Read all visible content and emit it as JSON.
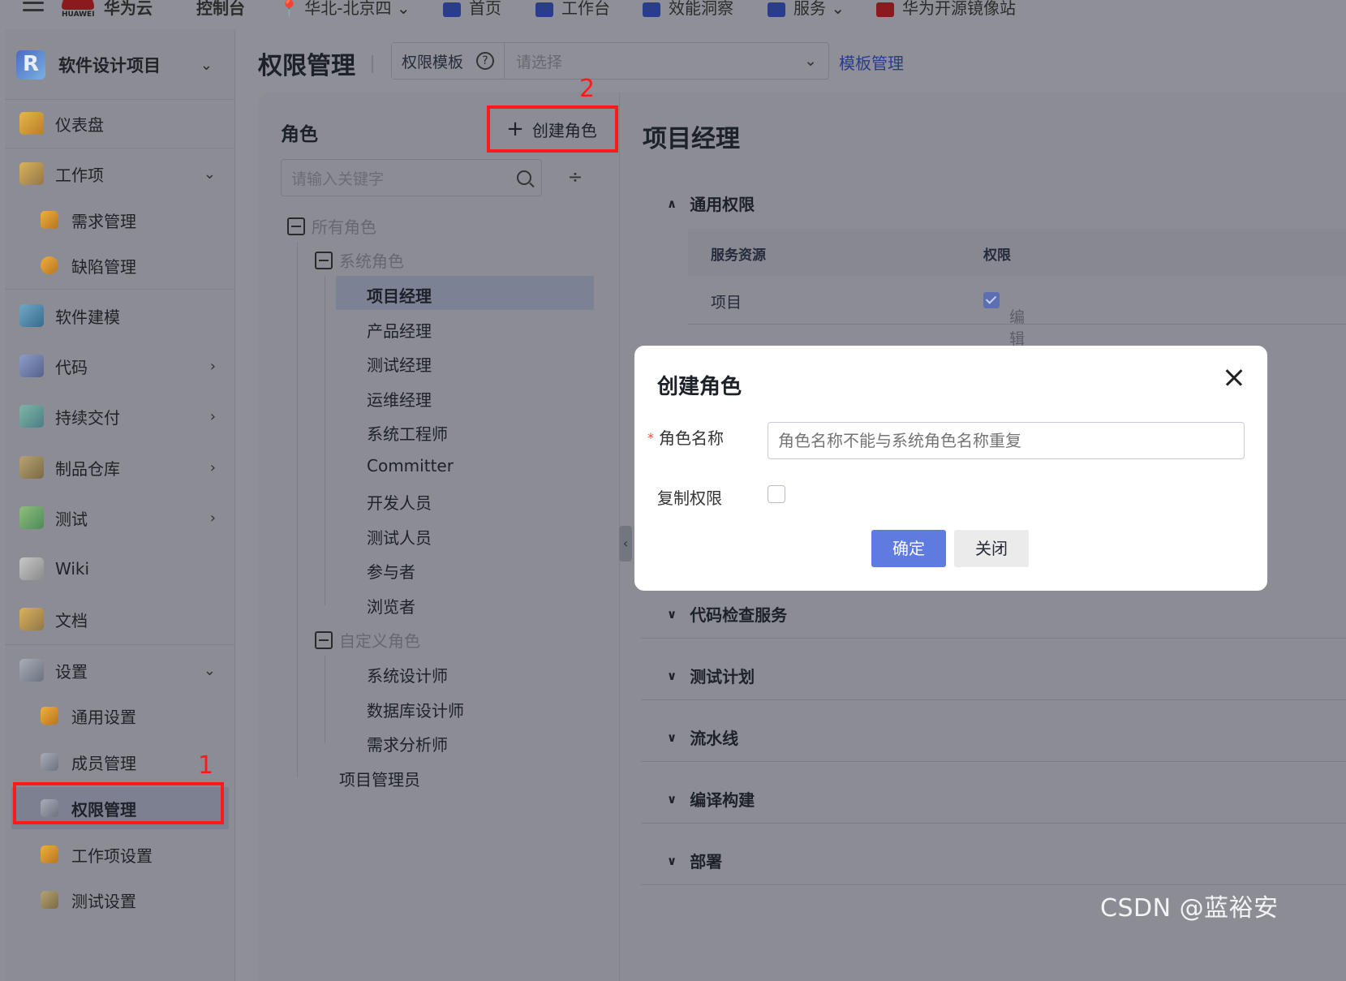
{
  "topnav": {
    "brand": "HUAWEI",
    "cloud_name": "华为云",
    "console": "控制台",
    "region": "华北-北京四",
    "home": "首页",
    "workbench": "工作台",
    "insight": "效能洞察",
    "services": "服务",
    "mirror": "华为开源镜像站"
  },
  "sidebar": {
    "project_name": "软件设计项目",
    "items": [
      {
        "label": "仪表盘"
      },
      {
        "label": "工作项"
      },
      {
        "label": "需求管理"
      },
      {
        "label": "缺陷管理"
      },
      {
        "label": "软件建模"
      },
      {
        "label": "代码"
      },
      {
        "label": "持续交付"
      },
      {
        "label": "制品仓库"
      },
      {
        "label": "测试"
      },
      {
        "label": "Wiki"
      },
      {
        "label": "文档"
      },
      {
        "label": "设置"
      },
      {
        "label": "通用设置"
      },
      {
        "label": "成员管理"
      },
      {
        "label": "权限管理"
      },
      {
        "label": "工作项设置"
      },
      {
        "label": "测试设置"
      }
    ]
  },
  "annotations": {
    "step1": "1",
    "step2": "2"
  },
  "header": {
    "title": "权限管理",
    "template_label": "权限模板",
    "template_placeholder": "请选择",
    "template_link": "模板管理"
  },
  "roles_panel": {
    "heading": "角色",
    "create_label": "创建角色",
    "search_placeholder": "请输入关键字",
    "root": "所有角色",
    "system_group": "系统角色",
    "system_roles": [
      "项目经理",
      "产品经理",
      "测试经理",
      "运维经理",
      "系统工程师",
      "Committer",
      "开发人员",
      "测试人员",
      "参与者",
      "浏览者"
    ],
    "custom_group": "自定义角色",
    "custom_roles": [
      "系统设计师",
      "数据库设计师",
      "需求分析师"
    ],
    "admin": "项目管理员"
  },
  "detail": {
    "title": "项目经理",
    "general_section": "通用权限",
    "col_resource": "服务资源",
    "col_permission": "权限",
    "row1_resource": "项目",
    "row1_perm": "编辑",
    "sections": [
      "代码检查服务",
      "测试计划",
      "流水线",
      "编译构建",
      "部署"
    ]
  },
  "dialog": {
    "title": "创建角色",
    "name_label": "角色名称",
    "name_placeholder": "角色名称不能与系统角色名称重复",
    "copy_label": "复制权限",
    "ok": "确定",
    "close": "关闭"
  },
  "watermark": "CSDN @蓝裕安"
}
